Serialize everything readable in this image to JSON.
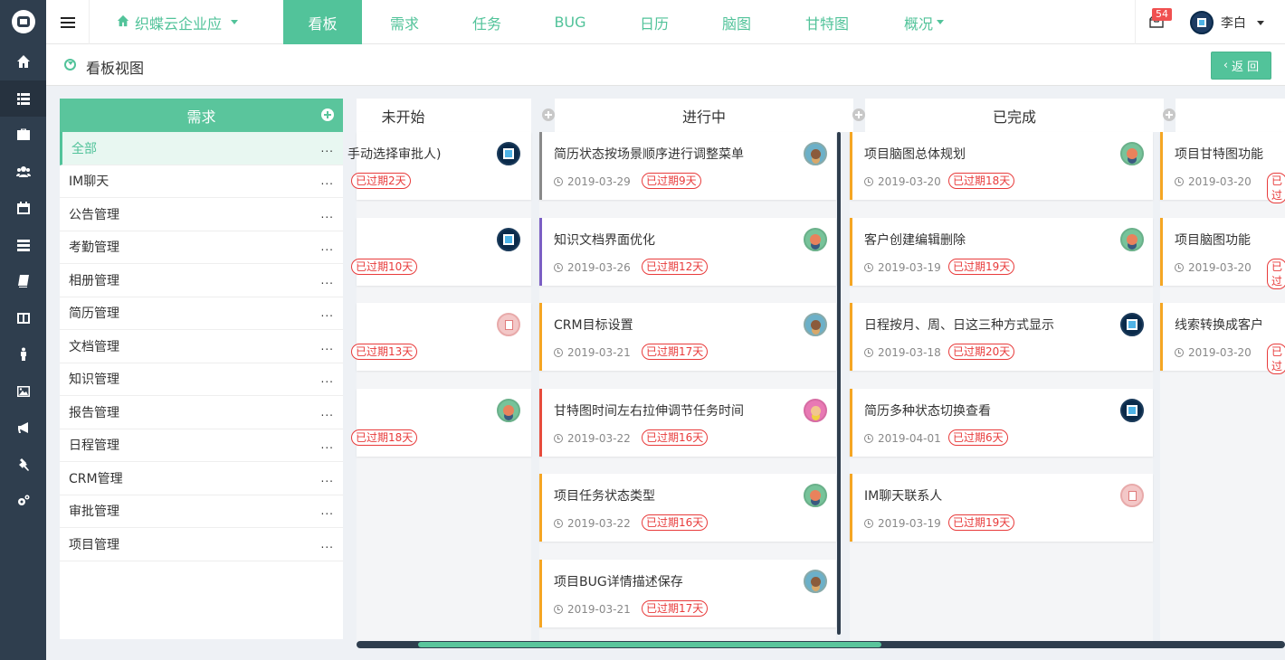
{
  "app": {
    "project_name": "织蝶云企业应",
    "tabs": [
      "看板",
      "需求",
      "任务",
      "BUG",
      "日历",
      "脑图",
      "甘特图",
      "概况"
    ],
    "active_tab": "看板",
    "mail_count": "54",
    "user_name": "李白",
    "accent": "#52c39a"
  },
  "page": {
    "title": "看板视图",
    "back_label": "返 回"
  },
  "rail_icons": [
    "home-icon",
    "list-icon",
    "briefcase-icon",
    "users-icon",
    "calendar-icon",
    "server-icon",
    "book-icon",
    "columns-icon",
    "person-icon",
    "image-icon",
    "megaphone-icon",
    "gavel-icon",
    "cogs-icon"
  ],
  "category_panel": {
    "title": "需求",
    "items": [
      {
        "label": "全部",
        "more": "..."
      },
      {
        "label": "IM聊天",
        "more": "..."
      },
      {
        "label": "公告管理",
        "more": "..."
      },
      {
        "label": "考勤管理",
        "more": "..."
      },
      {
        "label": "相册管理",
        "more": "..."
      },
      {
        "label": "简历管理",
        "more": "..."
      },
      {
        "label": "文档管理",
        "more": "..."
      },
      {
        "label": "知识管理",
        "more": "..."
      },
      {
        "label": "报告管理",
        "more": "..."
      },
      {
        "label": "日程管理",
        "more": "..."
      },
      {
        "label": "CRM管理",
        "more": "..."
      },
      {
        "label": "审批管理",
        "more": "..."
      },
      {
        "label": "项目管理",
        "more": "..."
      }
    ]
  },
  "columns": [
    {
      "name": "未开始",
      "cards": [
        {
          "title": "手动选择审批人)",
          "overdue": "已过期2天",
          "avatar": "logo"
        },
        {
          "title": "",
          "overdue": "已过期10天",
          "avatar": "logo"
        },
        {
          "title": "",
          "overdue": "已过期13天",
          "avatar": "paper"
        },
        {
          "title": "",
          "overdue": "已过期18天",
          "avatar": "p1"
        }
      ]
    },
    {
      "name": "进行中",
      "cards": [
        {
          "title": "简历状态按场景顺序进行调整菜单",
          "date": "2019-03-29",
          "overdue": "已过期9天",
          "avatar": "p2",
          "color": "#8a8a8a"
        },
        {
          "title": "知识文档界面优化",
          "date": "2019-03-26",
          "overdue": "已过期12天",
          "avatar": "p1",
          "color": "#7b5fc4"
        },
        {
          "title": "CRM目标设置",
          "date": "2019-03-21",
          "overdue": "已过期17天",
          "avatar": "p2",
          "color": "#f5a623"
        },
        {
          "title": "甘特图时间左右拉伸调节任务时间",
          "date": "2019-03-22",
          "overdue": "已过期16天",
          "avatar": "p3",
          "color": "#e74c3c"
        },
        {
          "title": "项目任务状态类型",
          "date": "2019-03-22",
          "overdue": "已过期16天",
          "avatar": "p1",
          "color": "#f5a623"
        },
        {
          "title": "项目BUG详情描述保存",
          "date": "2019-03-21",
          "overdue": "已过期17天",
          "avatar": "p2",
          "color": "#f5a623"
        }
      ]
    },
    {
      "name": "已完成",
      "cards": [
        {
          "title": "项目脑图总体规划",
          "date": "2019-03-20",
          "overdue": "已过期18天",
          "avatar": "p1",
          "color": "#f5a623"
        },
        {
          "title": "客户创建编辑删除",
          "date": "2019-03-19",
          "overdue": "已过期19天",
          "avatar": "p1",
          "color": "#f5a623"
        },
        {
          "title": "日程按月、周、日这三种方式显示",
          "date": "2019-03-18",
          "overdue": "已过期20天",
          "avatar": "logo",
          "color": "#f5a623"
        },
        {
          "title": "简历多种状态切换查看",
          "date": "2019-04-01",
          "overdue": "已过期6天",
          "avatar": "logo",
          "color": "#f5a623"
        },
        {
          "title": "IM聊天联系人",
          "date": "2019-03-19",
          "overdue": "已过期19天",
          "avatar": "paper",
          "color": "#f5a623"
        }
      ]
    },
    {
      "name": "",
      "cards": [
        {
          "title": "项目甘特图功能",
          "date": "2019-03-20",
          "overdue": "已过",
          "color": "#f5a623"
        },
        {
          "title": "项目脑图功能",
          "date": "2019-03-20",
          "overdue": "已过",
          "color": "#f5a623"
        },
        {
          "title": "线索转换成客户",
          "date": "2019-03-20",
          "overdue": "已过",
          "color": "#f5a623"
        }
      ]
    }
  ]
}
